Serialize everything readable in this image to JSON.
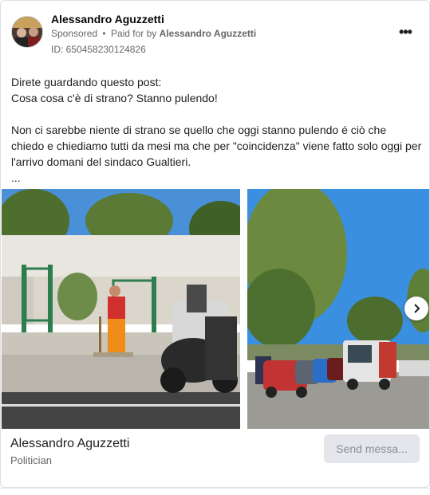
{
  "ad": {
    "author_name": "Alessandro Aguzzetti",
    "sponsored_label": "Sponsored",
    "separator": "•",
    "paid_for_prefix": "Paid for by",
    "paid_for_name": "Alessandro Aguzzetti",
    "id_label": "ID: 650458230124826",
    "more_icon": "ellipsis-icon",
    "more_glyph": "•••"
  },
  "post": {
    "lines": [
      "Direte guardando questo post:",
      "Cosa cosa c'è di strano? Stanno pulendo!",
      "",
      "Non ci sarebbe niente di strano se quello che oggi stanno pulendo é ciò che chiedo e chiediamo tutti da mesi ma che per \"coincidenza\" viene fatto solo oggi per l'arrivo domani del sindaco Gualtieri.",
      "..."
    ]
  },
  "carousel": {
    "next_icon": "chevron-right-icon",
    "slides": [
      {
        "image": "street-sweeper-worker-photo"
      },
      {
        "image": "parked-cars-street-cleaning-truck-photo"
      }
    ]
  },
  "footer": {
    "name": "Alessandro Aguzzetti",
    "role": "Politician",
    "cta_label": "Send messa..."
  },
  "colors": {
    "text_primary": "#1c1e21",
    "text_secondary": "#65676b",
    "button_disabled_bg": "#e4e6eb",
    "button_disabled_text": "#8a8d91"
  }
}
